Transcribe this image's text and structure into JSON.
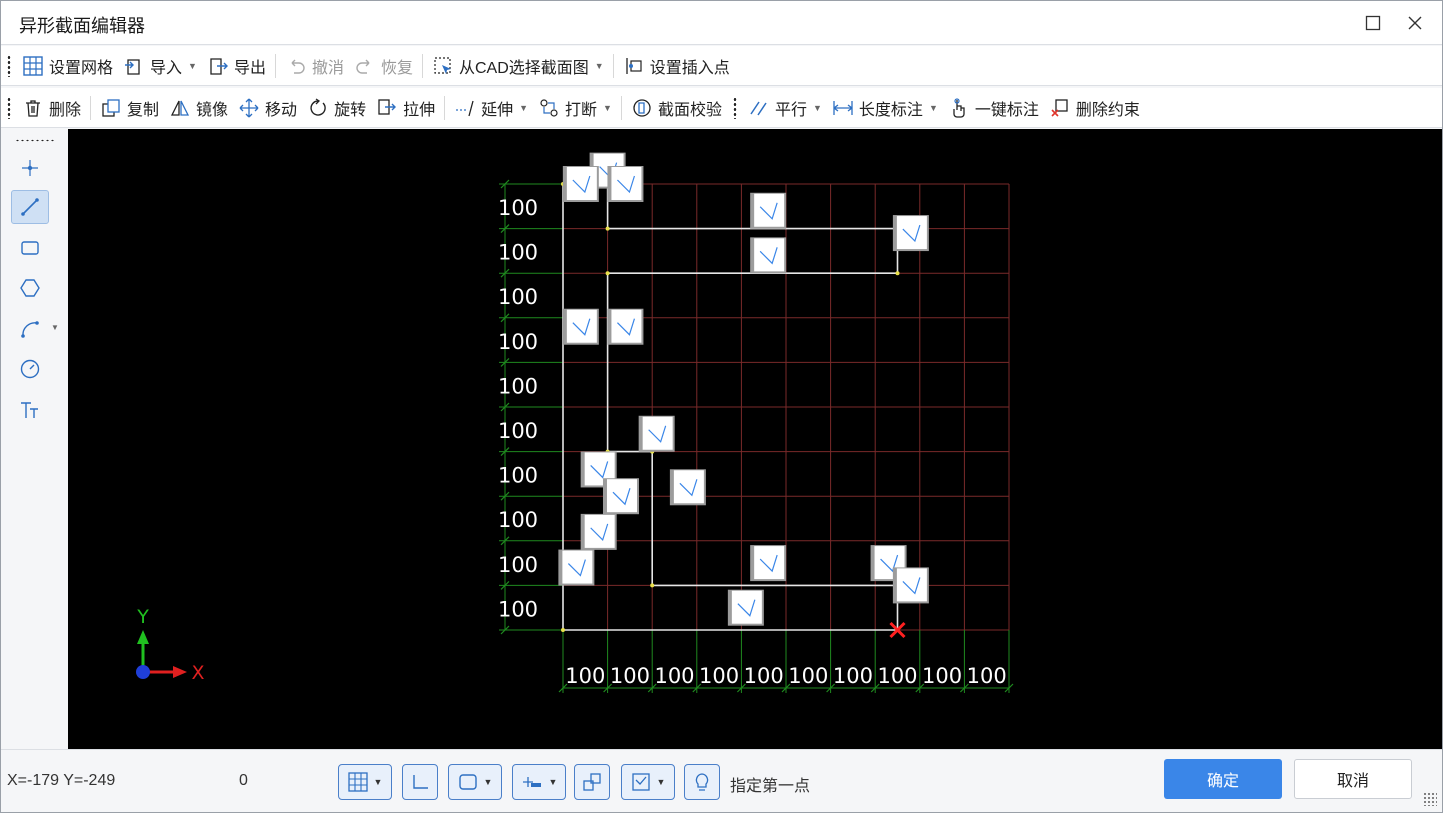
{
  "window": {
    "title": "异形截面编辑器"
  },
  "toolbar1": {
    "set_grid": "设置网格",
    "import": "导入",
    "export": "导出",
    "undo": "撤消",
    "redo": "恢复",
    "select_cad": "从CAD选择截面图",
    "set_insert_point": "设置插入点"
  },
  "toolbar2": {
    "delete": "删除",
    "copy": "复制",
    "mirror": "镜像",
    "move": "移动",
    "rotate": "旋转",
    "stretch": "拉伸",
    "extend": "延伸",
    "break": "打断",
    "section_check": "截面校验",
    "parallel": "平行",
    "length_dim": "长度标注",
    "one_key_dim": "一键标注",
    "delete_constraint": "删除约束"
  },
  "palette": {
    "tools": [
      "point-tool",
      "line-tool",
      "rectangle-tool",
      "polygon-tool",
      "arc-tool",
      "circle-tool",
      "text-tool"
    ],
    "active": "line-tool"
  },
  "canvas": {
    "grid_labels_y": [
      "100",
      "100",
      "100",
      "100",
      "100",
      "100",
      "100",
      "100",
      "100",
      "100"
    ],
    "grid_labels_x": [
      "100",
      "100",
      "100",
      "100",
      "100",
      "100",
      "100",
      "100",
      "100",
      "100"
    ],
    "axis_x_label": "X",
    "axis_y_label": "Y",
    "colors": {
      "background": "#000000",
      "grid": "#7a2a2a",
      "dim": "#1f8a1f",
      "outline": "#e6e6e6",
      "marker": "#ff2020"
    }
  },
  "status": {
    "coords": "X=-179 Y=-249",
    "value": "0",
    "prompt": "指定第一点",
    "ok": "确定",
    "cancel": "取消"
  }
}
